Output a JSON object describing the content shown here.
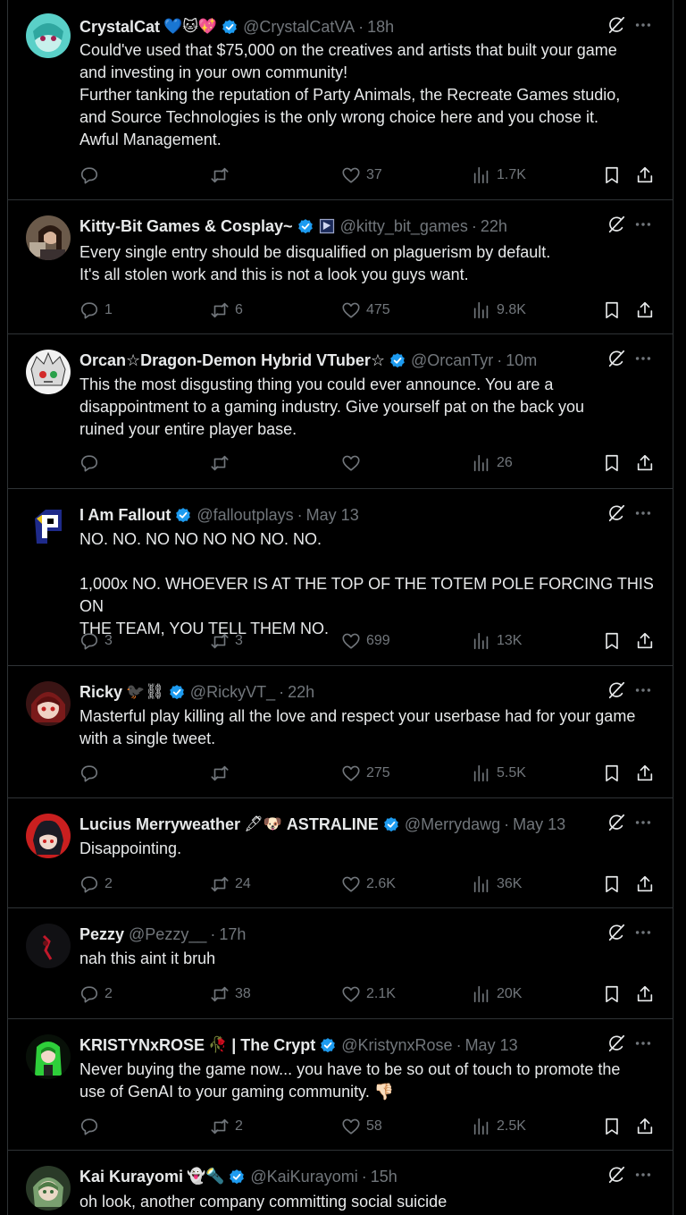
{
  "tweets": [
    {
      "name": "CrystalCat",
      "emoji": "💙🐱💖",
      "verified": true,
      "handle": "@CrystalCatVA",
      "time": "18h",
      "lines": [
        "Could've used that $75,000 on the creatives and artists that built your game",
        "and investing in your own community!",
        "Further tanking the reputation of Party Animals, the Recreate Games studio,",
        "and Source Technologies is the only wrong choice here and you chose it.",
        "Awful Management."
      ],
      "replies": "",
      "retweets": "",
      "likes": "37",
      "views": "1.7K"
    },
    {
      "name": "Kitty-Bit Games & Cosplay~",
      "emoji": "",
      "verified": true,
      "badge": true,
      "handle": "@kitty_bit_games",
      "time": "22h",
      "lines": [
        "Every single entry should be disqualified on plaguerism by default.",
        "It's all stolen work and this is not a look you guys want."
      ],
      "replies": "1",
      "retweets": "6",
      "likes": "475",
      "views": "9.8K"
    },
    {
      "name": "Orcan☆Dragon-Demon Hybrid VTuber☆",
      "emoji": "",
      "verified": true,
      "handle": "@OrcanTyr",
      "time": "10m",
      "lines": [
        "This the most disgusting thing you could ever announce. You are a",
        "disappointment to a gaming industry. Give yourself pat on the back you",
        "ruined your entire player base."
      ],
      "replies": "",
      "retweets": "",
      "likes": "",
      "views": "26"
    },
    {
      "name": "I Am Fallout",
      "emoji": "",
      "verified": true,
      "handle": "@falloutplays",
      "time": "May 13",
      "lines": [
        "NO.  NO.  NO NO NO NO  NO.  NO.",
        "",
        "1,000x NO.  WHOEVER IS AT THE TOP OF THE TOTEM POLE FORCING THIS ON",
        "THE TEAM, YOU TELL THEM NO."
      ],
      "replies": "3",
      "retweets": "3",
      "likes": "699",
      "views": "13K"
    },
    {
      "name": "Ricky",
      "emoji": "🐦‍⬛⛓",
      "verified": true,
      "handle": "@RickyVT_",
      "time": "22h",
      "lines": [
        "Masterful play killing all the love and respect your userbase had for your game",
        "with a single tweet."
      ],
      "replies": "",
      "retweets": "",
      "likes": "275",
      "views": "5.5K"
    },
    {
      "name": "Lucius Merryweather",
      "emoji": "🖋🐶",
      "name2": "ASTRALINE",
      "verified": true,
      "handle": "@Merrydawg",
      "time": "May 13",
      "lines": [
        "Disappointing."
      ],
      "replies": "2",
      "retweets": "24",
      "likes": "2.6K",
      "views": "36K"
    },
    {
      "name": "Pezzy",
      "emoji": "",
      "verified": false,
      "handle": "@Pezzy__",
      "time": "17h",
      "lines": [
        "nah this aint it bruh"
      ],
      "replies": "2",
      "retweets": "38",
      "likes": "2.1K",
      "views": "20K"
    },
    {
      "name": "KRISTYNxROSE",
      "emoji": "🥀",
      "name2": "| The Crypt",
      "verified": true,
      "handle": "@KristynxRose",
      "time": "May 13",
      "lines": [
        "Never buying the game now... you have to be so out of touch to promote the",
        "use of GenAI to your gaming community. 👎🏻"
      ],
      "replies": "",
      "retweets": "2",
      "likes": "58",
      "views": "2.5K"
    },
    {
      "name": "Kai Kurayomi",
      "emoji": "👻🔦",
      "verified": true,
      "handle": "@KaiKurayomi",
      "time": "15h",
      "lines": [
        "oh look, another company committing social suicide"
      ],
      "replies": "",
      "retweets": "",
      "likes": "",
      "views": ""
    }
  ]
}
